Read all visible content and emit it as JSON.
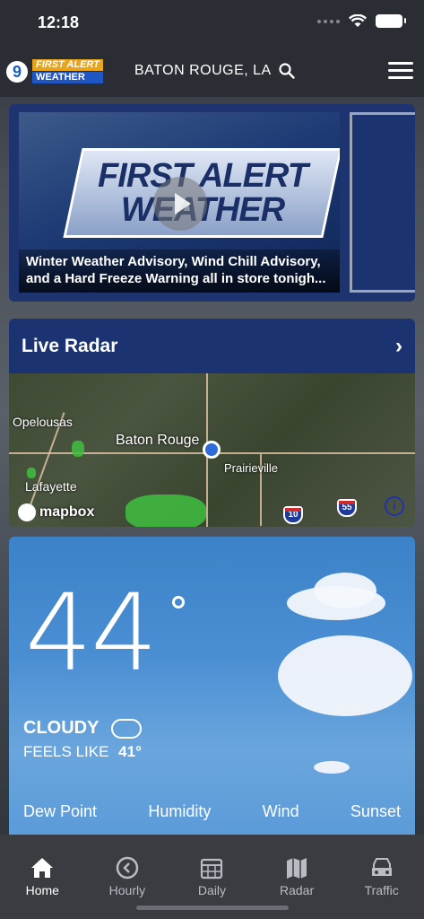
{
  "status_bar": {
    "time": "12:18"
  },
  "header": {
    "logo_number": "9",
    "logo_line1": "FIRST ALERT",
    "logo_line2": "WEATHER",
    "location": "BATON ROUGE, LA"
  },
  "video": {
    "graphic_text": "FIRST ALERT WEATHER",
    "caption": "Winter Weather Advisory, Wind Chill Advisory, and a Hard Freeze Warning all in store tonigh..."
  },
  "radar": {
    "title": "Live Radar",
    "labels": {
      "opelousas": "Opelousas",
      "baton_rouge": "Baton Rouge",
      "prairieville": "Prairieville",
      "lafayette": "Lafayette"
    },
    "shields": {
      "i10": "10",
      "i55": "55"
    },
    "attribution": "mapbox",
    "info": "i"
  },
  "current": {
    "temperature": "44",
    "condition": "CLOUDY",
    "feels_like_label": "FEELS LIKE",
    "feels_like_value": "41°",
    "stats": [
      {
        "label": "Dew Point"
      },
      {
        "label": "Humidity"
      },
      {
        "label": "Wind"
      },
      {
        "label": "Sunset"
      }
    ]
  },
  "tabs": [
    {
      "label": "Home",
      "icon": "home-icon"
    },
    {
      "label": "Hourly",
      "icon": "clock-icon"
    },
    {
      "label": "Daily",
      "icon": "calendar-icon"
    },
    {
      "label": "Radar",
      "icon": "map-icon"
    },
    {
      "label": "Traffic",
      "icon": "car-icon"
    }
  ]
}
